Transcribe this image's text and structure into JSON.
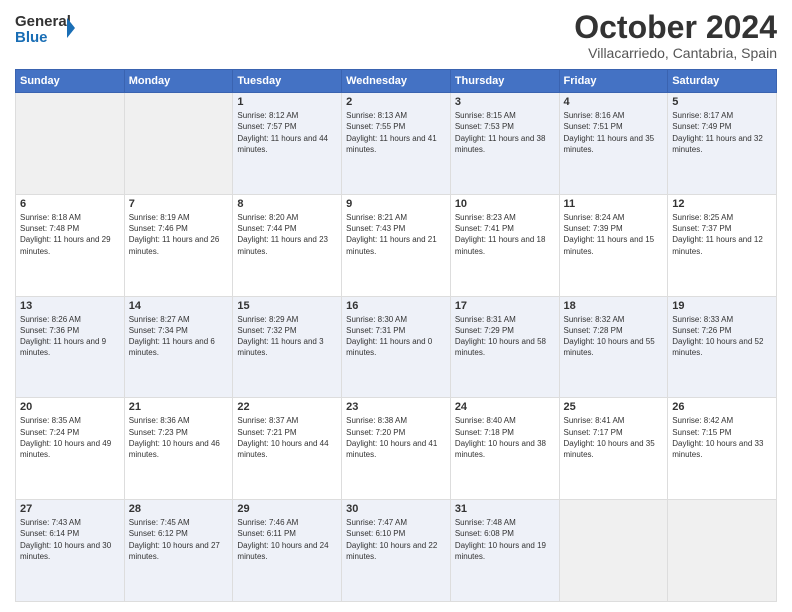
{
  "header": {
    "logo_general": "General",
    "logo_blue": "Blue",
    "title": "October 2024",
    "subtitle": "Villacarriedo, Cantabria, Spain"
  },
  "calendar": {
    "days_of_week": [
      "Sunday",
      "Monday",
      "Tuesday",
      "Wednesday",
      "Thursday",
      "Friday",
      "Saturday"
    ],
    "weeks": [
      [
        {
          "day": "",
          "empty": true
        },
        {
          "day": "",
          "empty": true
        },
        {
          "day": "1",
          "info": "Sunrise: 8:12 AM\nSunset: 7:57 PM\nDaylight: 11 hours and 44 minutes."
        },
        {
          "day": "2",
          "info": "Sunrise: 8:13 AM\nSunset: 7:55 PM\nDaylight: 11 hours and 41 minutes."
        },
        {
          "day": "3",
          "info": "Sunrise: 8:15 AM\nSunset: 7:53 PM\nDaylight: 11 hours and 38 minutes."
        },
        {
          "day": "4",
          "info": "Sunrise: 8:16 AM\nSunset: 7:51 PM\nDaylight: 11 hours and 35 minutes."
        },
        {
          "day": "5",
          "info": "Sunrise: 8:17 AM\nSunset: 7:49 PM\nDaylight: 11 hours and 32 minutes."
        }
      ],
      [
        {
          "day": "6",
          "info": "Sunrise: 8:18 AM\nSunset: 7:48 PM\nDaylight: 11 hours and 29 minutes."
        },
        {
          "day": "7",
          "info": "Sunrise: 8:19 AM\nSunset: 7:46 PM\nDaylight: 11 hours and 26 minutes."
        },
        {
          "day": "8",
          "info": "Sunrise: 8:20 AM\nSunset: 7:44 PM\nDaylight: 11 hours and 23 minutes."
        },
        {
          "day": "9",
          "info": "Sunrise: 8:21 AM\nSunset: 7:43 PM\nDaylight: 11 hours and 21 minutes."
        },
        {
          "day": "10",
          "info": "Sunrise: 8:23 AM\nSunset: 7:41 PM\nDaylight: 11 hours and 18 minutes."
        },
        {
          "day": "11",
          "info": "Sunrise: 8:24 AM\nSunset: 7:39 PM\nDaylight: 11 hours and 15 minutes."
        },
        {
          "day": "12",
          "info": "Sunrise: 8:25 AM\nSunset: 7:37 PM\nDaylight: 11 hours and 12 minutes."
        }
      ],
      [
        {
          "day": "13",
          "info": "Sunrise: 8:26 AM\nSunset: 7:36 PM\nDaylight: 11 hours and 9 minutes."
        },
        {
          "day": "14",
          "info": "Sunrise: 8:27 AM\nSunset: 7:34 PM\nDaylight: 11 hours and 6 minutes."
        },
        {
          "day": "15",
          "info": "Sunrise: 8:29 AM\nSunset: 7:32 PM\nDaylight: 11 hours and 3 minutes."
        },
        {
          "day": "16",
          "info": "Sunrise: 8:30 AM\nSunset: 7:31 PM\nDaylight: 11 hours and 0 minutes."
        },
        {
          "day": "17",
          "info": "Sunrise: 8:31 AM\nSunset: 7:29 PM\nDaylight: 10 hours and 58 minutes."
        },
        {
          "day": "18",
          "info": "Sunrise: 8:32 AM\nSunset: 7:28 PM\nDaylight: 10 hours and 55 minutes."
        },
        {
          "day": "19",
          "info": "Sunrise: 8:33 AM\nSunset: 7:26 PM\nDaylight: 10 hours and 52 minutes."
        }
      ],
      [
        {
          "day": "20",
          "info": "Sunrise: 8:35 AM\nSunset: 7:24 PM\nDaylight: 10 hours and 49 minutes."
        },
        {
          "day": "21",
          "info": "Sunrise: 8:36 AM\nSunset: 7:23 PM\nDaylight: 10 hours and 46 minutes."
        },
        {
          "day": "22",
          "info": "Sunrise: 8:37 AM\nSunset: 7:21 PM\nDaylight: 10 hours and 44 minutes."
        },
        {
          "day": "23",
          "info": "Sunrise: 8:38 AM\nSunset: 7:20 PM\nDaylight: 10 hours and 41 minutes."
        },
        {
          "day": "24",
          "info": "Sunrise: 8:40 AM\nSunset: 7:18 PM\nDaylight: 10 hours and 38 minutes."
        },
        {
          "day": "25",
          "info": "Sunrise: 8:41 AM\nSunset: 7:17 PM\nDaylight: 10 hours and 35 minutes."
        },
        {
          "day": "26",
          "info": "Sunrise: 8:42 AM\nSunset: 7:15 PM\nDaylight: 10 hours and 33 minutes."
        }
      ],
      [
        {
          "day": "27",
          "info": "Sunrise: 7:43 AM\nSunset: 6:14 PM\nDaylight: 10 hours and 30 minutes."
        },
        {
          "day": "28",
          "info": "Sunrise: 7:45 AM\nSunset: 6:12 PM\nDaylight: 10 hours and 27 minutes."
        },
        {
          "day": "29",
          "info": "Sunrise: 7:46 AM\nSunset: 6:11 PM\nDaylight: 10 hours and 24 minutes."
        },
        {
          "day": "30",
          "info": "Sunrise: 7:47 AM\nSunset: 6:10 PM\nDaylight: 10 hours and 22 minutes."
        },
        {
          "day": "31",
          "info": "Sunrise: 7:48 AM\nSunset: 6:08 PM\nDaylight: 10 hours and 19 minutes."
        },
        {
          "day": "",
          "empty": true
        },
        {
          "day": "",
          "empty": true
        }
      ]
    ]
  }
}
